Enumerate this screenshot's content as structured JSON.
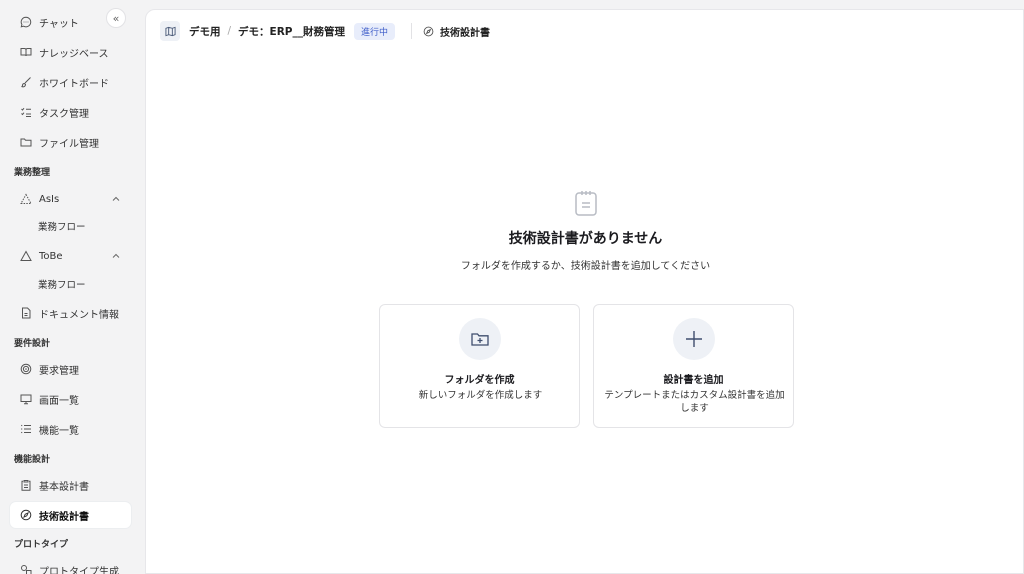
{
  "sidebar": {
    "collapse_glyph": "«",
    "items_top": [
      {
        "label": "チャット",
        "icon": "chat-icon"
      },
      {
        "label": "ナレッジベース",
        "icon": "book-icon"
      },
      {
        "label": "ホワイトボード",
        "icon": "brush-icon"
      },
      {
        "label": "タスク管理",
        "icon": "task-list-icon"
      },
      {
        "label": "ファイル管理",
        "icon": "folder-icon"
      }
    ],
    "sections": [
      {
        "label": "業務整理"
      },
      {
        "label": "要件設計"
      },
      {
        "label": "機能設計"
      },
      {
        "label": "プロトタイプ"
      }
    ],
    "asis": {
      "label": "AsIs",
      "sub": "業務フロー"
    },
    "tobe": {
      "label": "ToBe",
      "sub": "業務フロー"
    },
    "document_info": {
      "label": "ドキュメント情報"
    },
    "requirement_items": [
      {
        "label": "要求管理"
      },
      {
        "label": "画面一覧"
      },
      {
        "label": "機能一覧"
      }
    ],
    "design_items": [
      {
        "label": "基本設計書"
      },
      {
        "label": "技術設計書"
      }
    ],
    "prototype_item": {
      "label": "プロトタイプ生成"
    }
  },
  "topbar": {
    "breadcrumb_root": "デモ用",
    "separator": "/",
    "project": "デモ：ERP__財務管理",
    "status": "進行中",
    "page_title": "技術設計書"
  },
  "empty_state": {
    "title": "技術設計書がありません",
    "subtitle": "フォルダを作成するか、技術設計書を追加してください"
  },
  "cards": {
    "create_folder": {
      "title": "フォルダを作成",
      "desc": "新しいフォルダを作成します"
    },
    "add_doc": {
      "title": "設計書を追加",
      "desc": "テンプレートまたはカスタム設計書を追加します"
    }
  },
  "colors": {
    "accent": "#3f5ec9",
    "badge_bg": "#e8edfb",
    "sidebar_bg": "#f3f3f4"
  }
}
